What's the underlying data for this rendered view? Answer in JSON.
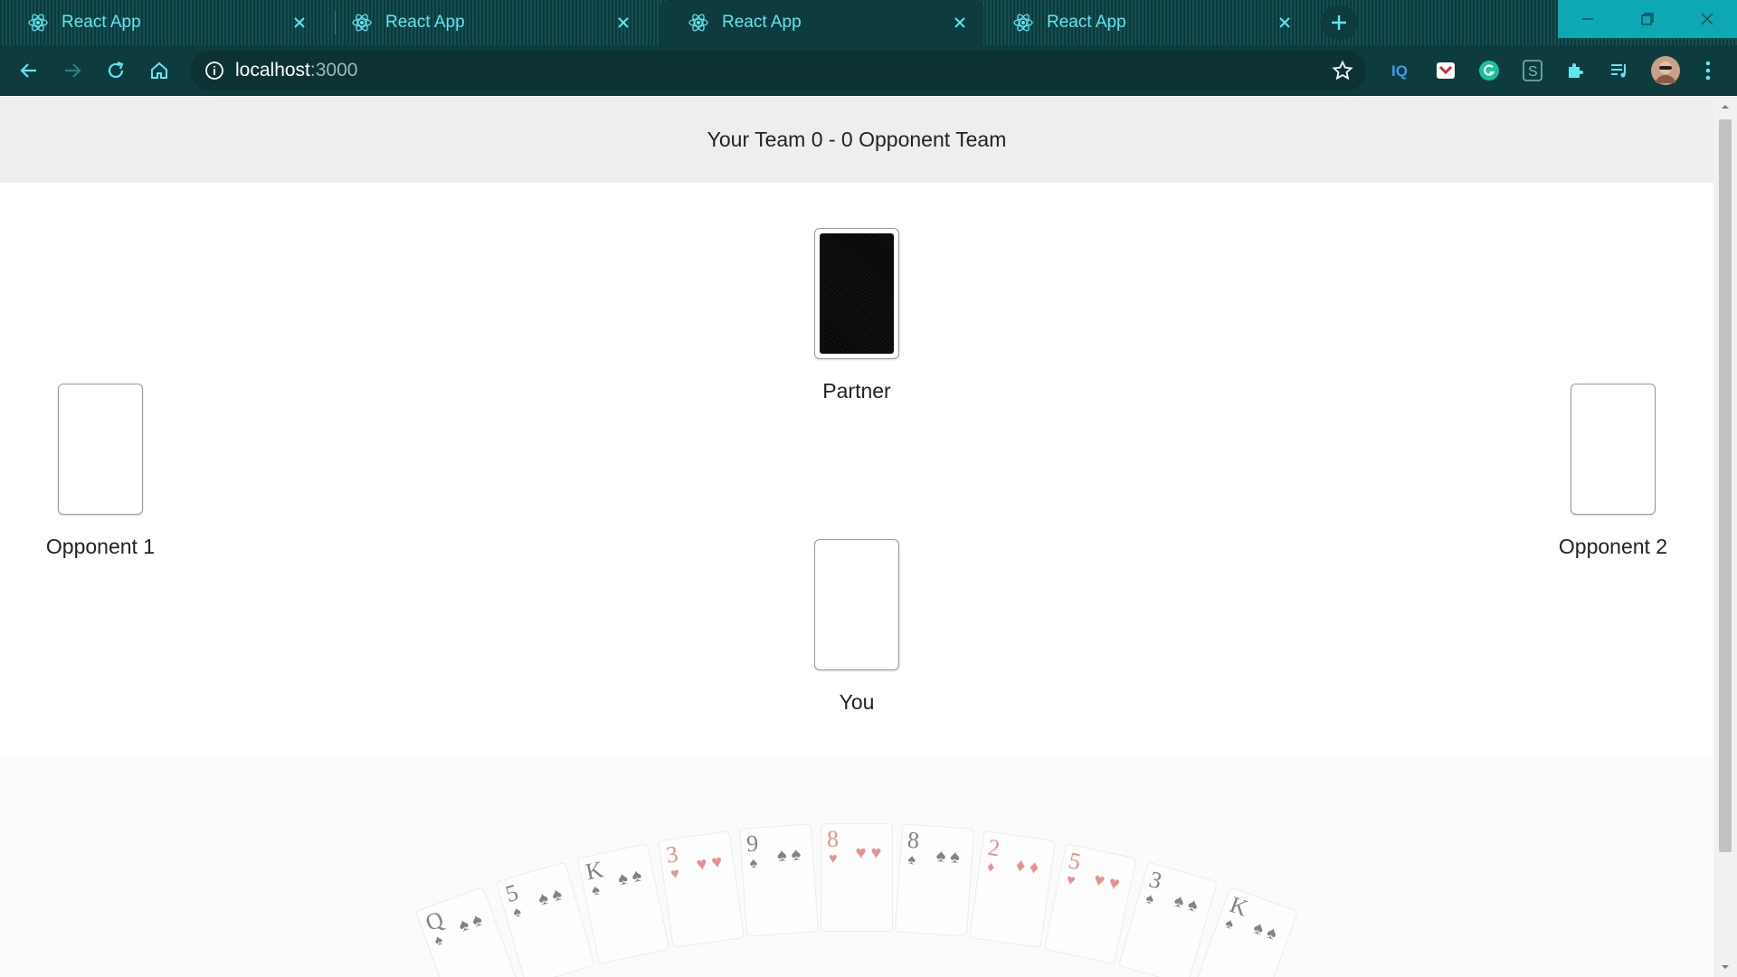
{
  "browser": {
    "tabs": [
      {
        "title": "React App",
        "active": false
      },
      {
        "title": "React App",
        "active": false
      },
      {
        "title": "React App",
        "active": true
      },
      {
        "title": "React App",
        "active": false
      }
    ],
    "url_host": "localhost",
    "url_port": ":3000",
    "accent_color": "#5fe6ee",
    "chrome_color": "#0e3b3e",
    "extensions": [
      "iq-icon",
      "pocket-icon",
      "grammarly-icon",
      "s-extension-icon",
      "puzzle-icon",
      "media-queue-icon",
      "avatar",
      "more-vert-icon"
    ]
  },
  "game": {
    "score_text": "Your Team 0 - 0 Opponent Team",
    "players": {
      "partner": {
        "name": "Partner",
        "card": "back"
      },
      "opponent1": {
        "name": "Opponent 1",
        "card": "empty"
      },
      "opponent2": {
        "name": "Opponent 2",
        "card": "empty"
      },
      "you": {
        "name": "You",
        "card": "empty"
      }
    },
    "hand": [
      {
        "rank": "Q",
        "suit": "♠",
        "color": "#222222"
      },
      {
        "rank": "5",
        "suit": "♠",
        "color": "#222222"
      },
      {
        "rank": "K",
        "suit": "♠",
        "color": "#222222"
      },
      {
        "rank": "3",
        "suit": "♥",
        "color": "#d83a3a"
      },
      {
        "rank": "9",
        "suit": "♠",
        "color": "#222222"
      },
      {
        "rank": "8",
        "suit": "♥",
        "color": "#d83a3a"
      },
      {
        "rank": "8",
        "suit": "♠",
        "color": "#222222"
      },
      {
        "rank": "2",
        "suit": "♦",
        "color": "#d83a3a"
      },
      {
        "rank": "5",
        "suit": "♥",
        "color": "#d83a3a"
      },
      {
        "rank": "3",
        "suit": "♠",
        "color": "#222222"
      },
      {
        "rank": "K",
        "suit": "♠",
        "color": "#222222"
      }
    ]
  }
}
